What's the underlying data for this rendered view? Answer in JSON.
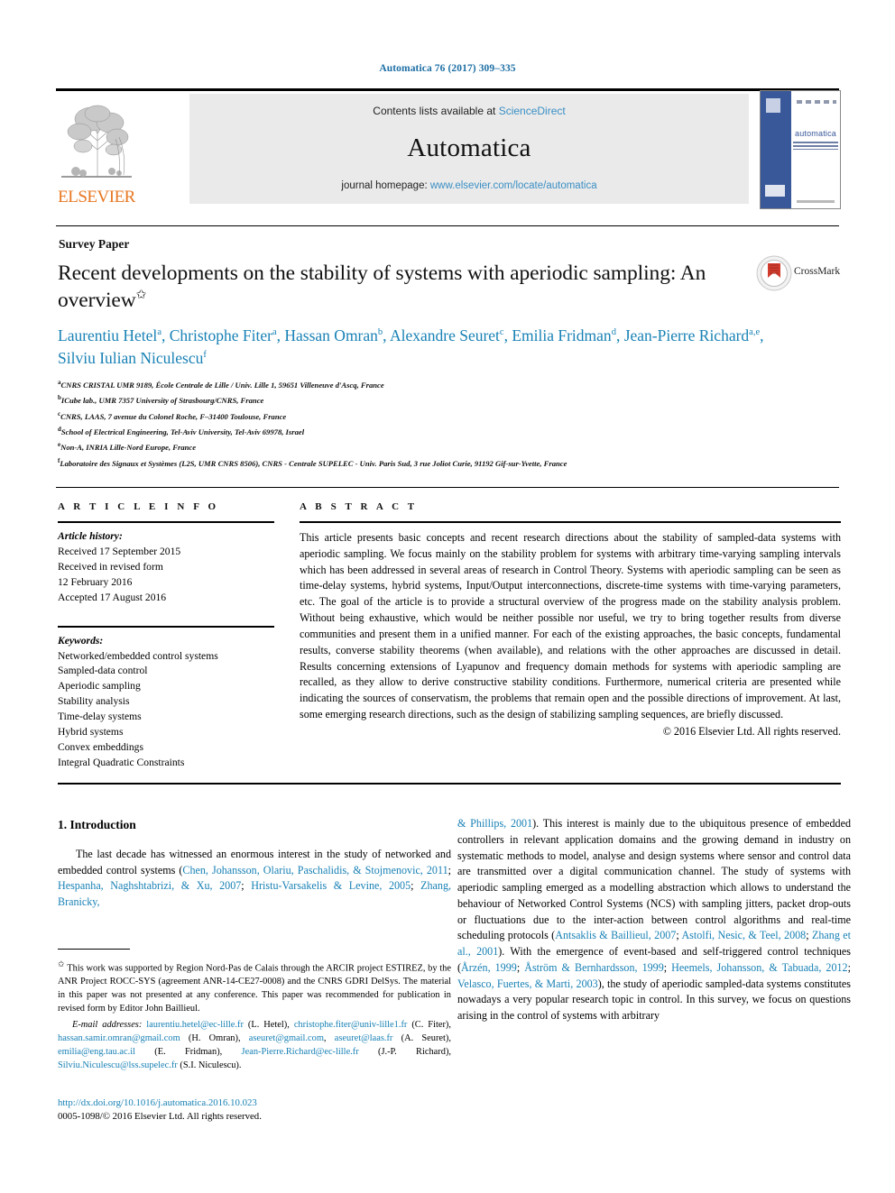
{
  "running_head": "Automatica 76 (2017) 309–335",
  "masthead": {
    "contents_prefix": "Contents lists available at ",
    "sciencedirect": "ScienceDirect",
    "journal_title": "Automatica",
    "homepage_prefix": "journal homepage: ",
    "homepage_url": "www.elsevier.com/locate/automatica",
    "publisher_logo": "ELSEVIER",
    "cover_title": "automatica",
    "cover_alt": "journal-cover-thumbnail"
  },
  "article": {
    "type": "Survey Paper",
    "title": "Recent developments on the stability of systems with aperiodic sampling: An overview",
    "title_footnote_marker": "✩",
    "crossmark_label": "CrossMark",
    "authors_line1": "Laurentiu Hetel",
    "authors": [
      {
        "name": "Laurentiu Hetel",
        "sup": "a"
      },
      {
        "name": "Christophe Fiter",
        "sup": "a"
      },
      {
        "name": "Hassan Omran",
        "sup": "b"
      },
      {
        "name": "Alexandre Seuret",
        "sup": "c"
      },
      {
        "name": "Emilia Fridman",
        "sup": "d"
      },
      {
        "name": "Jean-Pierre Richard",
        "sup": "a,e"
      },
      {
        "name": "Silviu Iulian Niculescu",
        "sup": "f"
      }
    ],
    "affiliations": [
      {
        "marker": "a",
        "text": "CNRS CRISTAL UMR 9189, École Centrale de Lille / Univ. Lille 1, 59651 Villeneuve d'Ascq, France"
      },
      {
        "marker": "b",
        "text": "ICube lab., UMR 7357 University of Strasbourg/CNRS, France"
      },
      {
        "marker": "c",
        "text": "CNRS, LAAS, 7 avenue du Colonel Roche, F–31400 Toulouse, France"
      },
      {
        "marker": "d",
        "text": "School of Electrical Engineering, Tel-Aviv University, Tel-Aviv 69978, Israel"
      },
      {
        "marker": "e",
        "text": "Non-A, INRIA Lille-Nord Europe, France"
      },
      {
        "marker": "f",
        "text": "Laboratoire des Signaux et Systèmes (L2S, UMR CNRS 8506), CNRS - Centrale SUPELEC - Univ. Paris Sud, 3 rue Joliot Curie, 91192 Gif-sur-Yvette, France"
      }
    ]
  },
  "info": {
    "heading": "A R T I C L E   I N F O",
    "history_label": "Article history:",
    "history": [
      "Received 17 September 2015",
      "Received in revised form",
      "12 February 2016",
      "Accepted 17 August 2016"
    ],
    "keywords_label": "Keywords:",
    "keywords": [
      "Networked/embedded control systems",
      "Sampled-data control",
      "Aperiodic sampling",
      "Stability analysis",
      "Time-delay systems",
      "Hybrid systems",
      "Convex embeddings",
      "Integral Quadratic Constraints"
    ]
  },
  "abstract": {
    "heading": "A B S T R A C T",
    "text": "This article presents basic concepts and recent research directions about the stability of sampled-data systems with aperiodic sampling. We focus mainly on the stability problem for systems with arbitrary time-varying sampling intervals which has been addressed in several areas of research in Control Theory. Systems with aperiodic sampling can be seen as time-delay systems, hybrid systems, Input/Output interconnections, discrete-time systems with time-varying parameters, etc. The goal of the article is to provide a structural overview of the progress made on the stability analysis problem. Without being exhaustive, which would be neither possible nor useful, we try to bring together results from diverse communities and present them in a unified manner. For each of the existing approaches, the basic concepts, fundamental results, converse stability theorems (when available), and relations with the other approaches are discussed in detail. Results concerning extensions of Lyapunov and frequency domain methods for systems with aperiodic sampling are recalled, as they allow to derive constructive stability conditions. Furthermore, numerical criteria are presented while indicating the sources of conservatism, the problems that remain open and the possible directions of improvement. At last, some emerging research directions, such as the design of stabilizing sampling sequences, are briefly discussed.",
    "copyright": "© 2016 Elsevier Ltd. All rights reserved."
  },
  "body": {
    "section_number_title": "1. Introduction",
    "left_par_lead": "The last decade has witnessed an enormous interest in the study of networked and embedded control systems (",
    "left_refs_1": "Chen, Johansson, Olariu, Paschalidis, & Stojmenovic, 2011",
    "sep1": "; ",
    "left_refs_2": "Hespanha, Naghshtabrizi, & Xu, 2007",
    "sep2": "; ",
    "left_refs_3": "Hristu-Varsakelis & Levine, 2005",
    "sep3": "; ",
    "left_refs_4": "Zhang, Branicky,",
    "right_refs_0": "& Phillips, 2001",
    "right_text_1": "). This interest is mainly due to the ubiquitous presence of embedded controllers in relevant application domains and the growing demand in industry on systematic methods to model, analyse and design systems where sensor and control data are transmitted over a digital communication channel. The study of systems with aperiodic sampling emerged as a modelling abstraction which allows to understand the behaviour of Networked Control Systems (NCS) with sampling jitters, packet drop-outs or fluctuations due to the inter-action between control algorithms and real-time scheduling protocols (",
    "right_refs_1": "Antsaklis & Baillieul, 2007",
    "right_refs_2": "Astolfi, Nesic, & Teel, 2008",
    "right_refs_3": "Zhang et al., 2001",
    "right_text_2": "). With the emergence of event-based and self-triggered control techniques (",
    "right_refs_4": "Årzén, 1999",
    "right_refs_5": "Åström & Bernhardsson, 1999",
    "right_refs_6": "Heemels, Johansson, & Tabuada, 2012",
    "right_refs_7": "Velasco, Fuertes, & Marti, 2003",
    "right_text_3": "), the study of aperiodic sampled-data systems constitutes nowadays a very popular research topic in control. In this survey, we focus on questions arising in the control of systems with arbitrary"
  },
  "footnotes": {
    "star": "✩",
    "funding": "This work was supported by Region Nord-Pas de Calais through the ARCIR project ESTIREZ, by the ANR Project ROCC-SYS (agreement ANR-14-CE27-0008) and the CNRS GDRI DelSys. The material in this paper was not presented at any conference. This paper was recommended for publication in revised form by Editor John Baillieul.",
    "email_label": "E-mail addresses:",
    "emails": [
      {
        "addr": "laurentiu.hetel@ec-lille.fr",
        "who": " (L. Hetel), "
      },
      {
        "addr": "christophe.fiter@univ-lille1.fr",
        "who": " (C. Fiter), "
      },
      {
        "addr": "hassan.samir.omran@gmail.com",
        "who": " (H. Omran), "
      },
      {
        "addr": "aseuret@gmail.com",
        "who": ", "
      },
      {
        "addr": "aseuret@laas.fr",
        "who": " (A. Seuret), "
      },
      {
        "addr": "emilia@eng.tau.ac.il",
        "who": " (E. Fridman), "
      },
      {
        "addr": "Jean-Pierre.Richard@ec-lille.fr",
        "who": " (J.-P. Richard), "
      },
      {
        "addr": "Silviu.Niculescu@lss.supelec.fr",
        "who": " (S.I. Niculescu)."
      }
    ]
  },
  "footer": {
    "doi": "http://dx.doi.org/10.1016/j.automatica.2016.10.023",
    "issn_copyright": "0005-1098/© 2016 Elsevier Ltd. All rights reserved."
  },
  "colors": {
    "link": "#1881b5",
    "masthead_link": "#3a8fc4",
    "runhead": "#1d6fa5",
    "elsevier_orange": "#e87722"
  }
}
